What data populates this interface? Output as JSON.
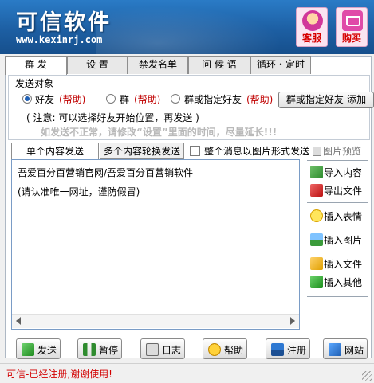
{
  "header": {
    "title": "可信软件",
    "url": "www.kexinrj.com",
    "service_label": "客服",
    "buy_label": "购买",
    "colors": {
      "banner": "#1d5fa3",
      "accent_red": "#d60000"
    }
  },
  "tabs": [
    "群 发",
    "设 置",
    "禁发名单",
    "问 候 语",
    "循环・定时"
  ],
  "send_target": {
    "legend": "发送对象",
    "options": [
      {
        "label": "好友",
        "help": "(帮助)",
        "selected": true
      },
      {
        "label": "群",
        "help": "(帮助)",
        "selected": false
      },
      {
        "label": "群或指定好友",
        "help": "(帮助)",
        "selected": false
      }
    ],
    "add_button": "群或指定好友-添加",
    "note": "( 注意: 可以选择好友开始位置，再发送 )",
    "warning": "如发送不正常，请修改“设置”里面的时间，尽量延长!!!"
  },
  "content": {
    "tabs": [
      "单个内容发送",
      "多个内容轮换发送"
    ],
    "image_checkbox_label": "整个消息以图片形式发送",
    "image_checkbox_checked": false,
    "preview_label": "图片预览",
    "lines": [
      "吾爱百分百营销官网/吾爱百分百营销软件",
      "(请认准唯一网址，谨防假冒)"
    ]
  },
  "side_buttons": {
    "import": "导入内容",
    "export": "导出文件",
    "emoji": "插入表情",
    "image": "插入图片",
    "file": "插入文件",
    "other": "插入其他"
  },
  "bottom_buttons": {
    "send": "发送",
    "pause": "暂停",
    "log": "日志",
    "help": "帮助",
    "register": "注册",
    "website": "网站"
  },
  "status": "可信-已经注册,谢谢使用!"
}
